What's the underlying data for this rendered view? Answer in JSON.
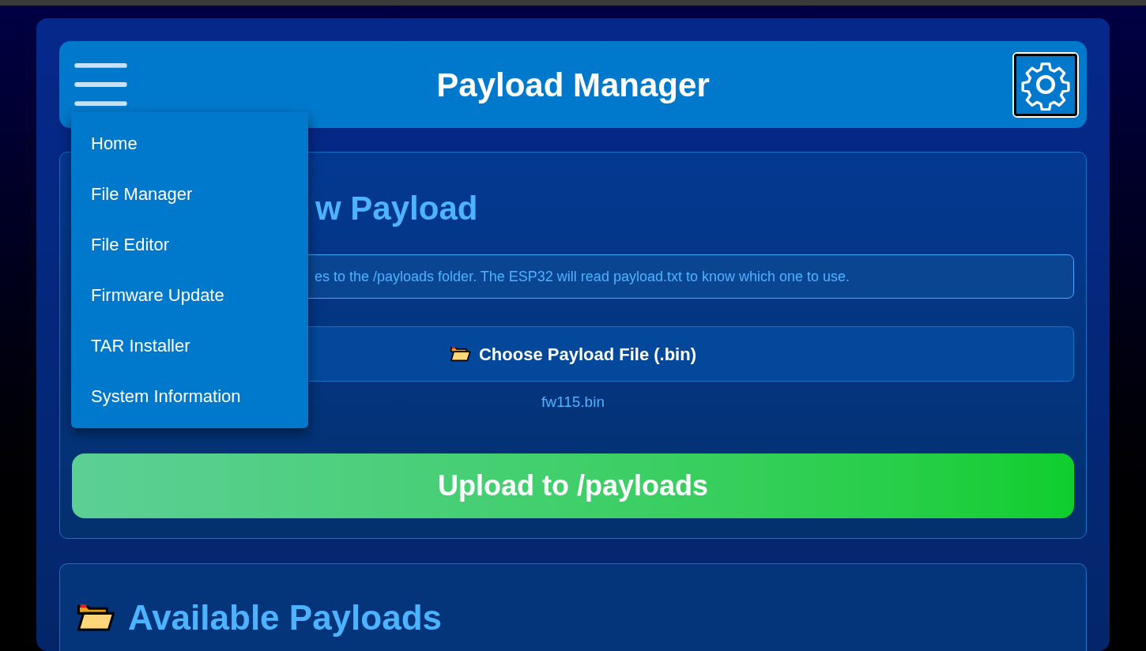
{
  "header": {
    "title": "Payload Manager"
  },
  "menu": {
    "expanded": true,
    "items": [
      {
        "label": "Home"
      },
      {
        "label": "File Manager"
      },
      {
        "label": "File Editor"
      },
      {
        "label": "Firmware Update"
      },
      {
        "label": "TAR Installer"
      },
      {
        "label": "System Information"
      }
    ]
  },
  "upload_card": {
    "title": "w Payload",
    "info": "es to the /payloads folder. The ESP32 will read payload.txt to know which one to use.",
    "choose_button": "Choose Payload File (.bin)",
    "file_name": "fw115.bin",
    "upload_button": "Upload to /payloads"
  },
  "payloads_card": {
    "title": "Available Payloads"
  }
}
